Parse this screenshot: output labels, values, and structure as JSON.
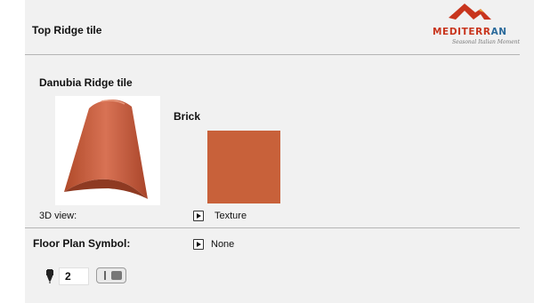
{
  "header": {
    "title": "Top Ridge tile",
    "logo": {
      "brand_main": "MEDITERR",
      "brand_accent": "AN",
      "tagline": "Seasonal Italian Moment"
    }
  },
  "main": {
    "product_name": "Danubia Ridge tile",
    "view_label": "3D view:",
    "material": {
      "name": "Brick",
      "color": "#c8613a",
      "texture_label": "Texture"
    }
  },
  "floor_plan": {
    "label": "Floor Plan Symbol:",
    "value": "None",
    "pen_number": "2"
  },
  "colors": {
    "tile": "#c8613a",
    "logo_red": "#c8351d",
    "logo_blue": "#2a6a9b"
  }
}
